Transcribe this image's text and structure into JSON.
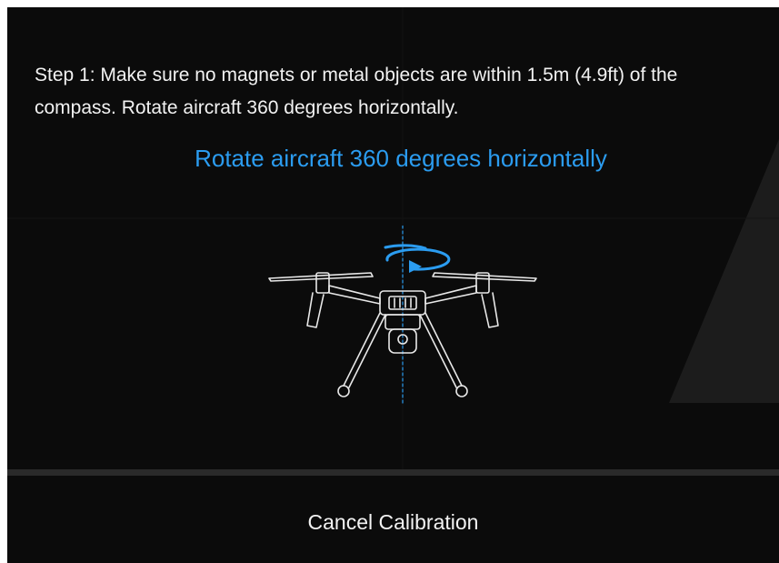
{
  "dialog": {
    "instruction": "Step 1: Make sure no magnets or metal objects are within 1.5m (4.9ft) of the compass. Rotate aircraft 360 degrees horizontally.",
    "subtitle": "Rotate aircraft 360 degrees horizontally",
    "illustration": "drone-rotate-horizontal-icon",
    "cancel_label": "Cancel Calibration"
  },
  "colors": {
    "background": "#0b0b0b",
    "accent": "#2b9cf0",
    "text": "#f2f2f2",
    "divider": "#2a2a2a"
  }
}
